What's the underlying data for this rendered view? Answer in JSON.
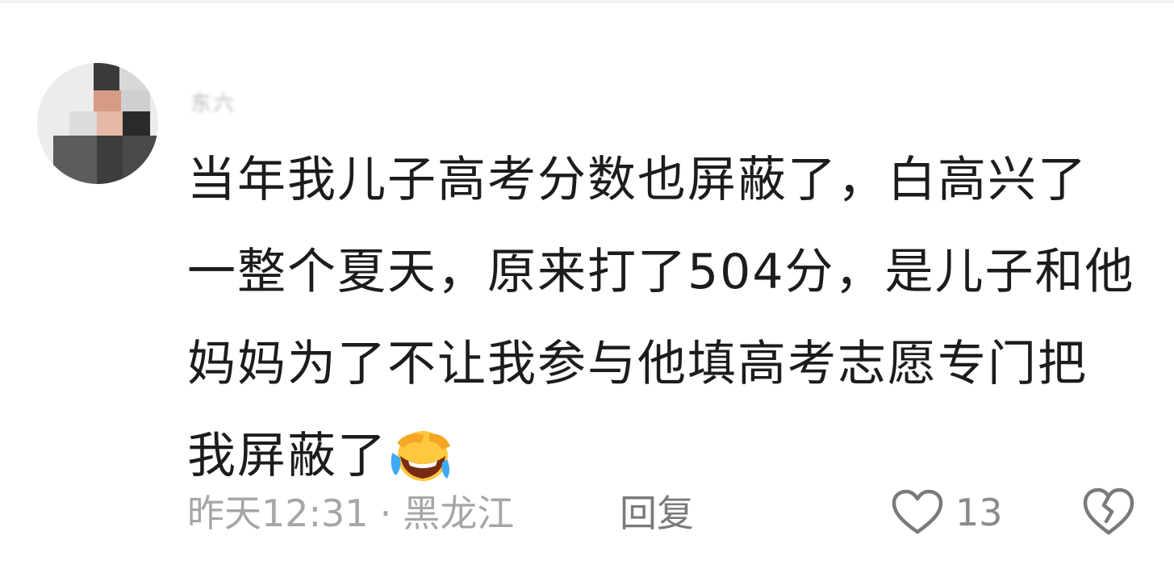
{
  "comment": {
    "username": "东六",
    "text_lines": [
      "当年我儿子高考分数也屏蔽了，白高兴了",
      "一整个夏天，原来打了504分，是儿子和他",
      "妈妈为了不让我参与他填高考志愿专门把",
      "我屏蔽了"
    ],
    "emoji": "laughing-crying-emoji",
    "time": "昨天12:31",
    "separator": "·",
    "location": "黑龙江",
    "reply_label": "回复",
    "like_count": "13",
    "like_icon": "heart-outline-icon",
    "dislike_icon": "broken-heart-icon"
  },
  "colors": {
    "text": "#1c1c1c",
    "meta": "#a6a6a6",
    "icon": "#7a7a7a"
  }
}
